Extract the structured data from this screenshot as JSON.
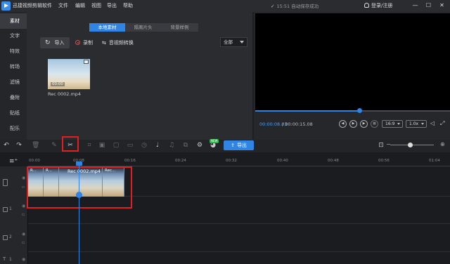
{
  "window": {
    "title": "迅捷视频剪辑软件",
    "menu": [
      "文件",
      "编辑",
      "视图",
      "导出",
      "帮助"
    ],
    "status": "15:51 自动保存成功",
    "login": "登录/注册",
    "controls": [
      "minimize-icon",
      "restore-icon",
      "close-icon"
    ]
  },
  "sidebar": {
    "items": [
      {
        "label": "素材",
        "active": true
      },
      {
        "label": "文字",
        "active": false
      },
      {
        "label": "特效",
        "active": false
      },
      {
        "label": "转场",
        "active": false
      },
      {
        "label": "滤镜",
        "active": false
      },
      {
        "label": "叠附",
        "active": false
      },
      {
        "label": "贴纸",
        "active": false
      },
      {
        "label": "配乐",
        "active": false
      }
    ]
  },
  "media": {
    "tabs": [
      {
        "label": "本地素材",
        "active": true
      },
      {
        "label": "隔离片头",
        "active": false
      },
      {
        "label": "背景样例",
        "active": false
      }
    ],
    "import_label": "导入",
    "record_label": "录制",
    "convert_label": "音视频转换",
    "filter_value": "全部",
    "items": [
      {
        "name": "Rec 0002.mp4",
        "duration": "00:00"
      }
    ]
  },
  "preview": {
    "current_time": "00:00:08.03",
    "total_time": "/ 00:00:15.08",
    "progress_fraction": 0.53,
    "aspect": "16:9",
    "speed": "1.0x"
  },
  "toolbar": {
    "export_label": "导出",
    "new_badge": "NEW",
    "accent_color": "#2f84e4",
    "highlight_color": "#e02020"
  },
  "timeline": {
    "ruler_ticks": [
      "00:00",
      "00:08",
      "00:16",
      "00:24",
      "00:32",
      "00:40",
      "00:48",
      "00:56",
      "01:04"
    ],
    "tracks": [
      {
        "label": "",
        "type": "video"
      },
      {
        "label": "1",
        "type": "picture"
      },
      {
        "label": "2",
        "type": "picture"
      },
      {
        "label": "1",
        "type": "text"
      }
    ],
    "clip": {
      "title": "Rec 0002.mp4",
      "frame_labels": [
        "R...",
        "R...",
        "Rec...",
        "Rec..."
      ]
    }
  }
}
